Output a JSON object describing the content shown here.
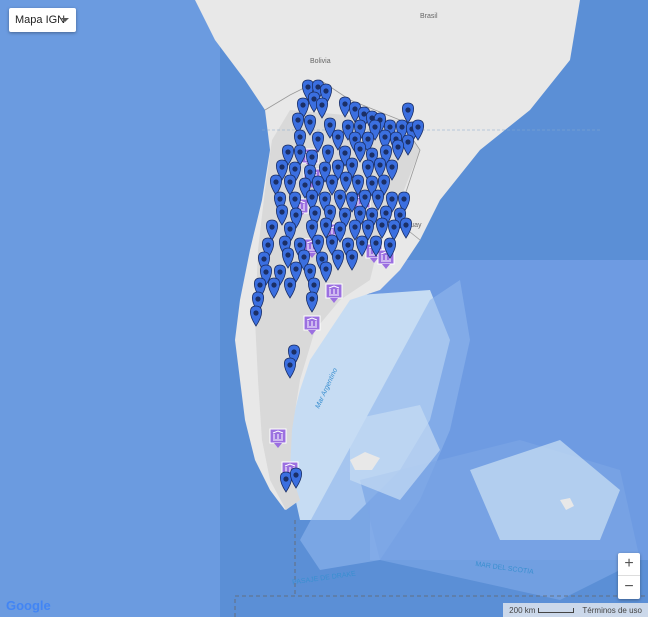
{
  "map_type": {
    "label": "Mapa IGN"
  },
  "place_labels": {
    "brasil": "Brasil",
    "bolivia": "Bolivia",
    "uruguay": "Uruguay",
    "mar_argentino": "Mar Argentino",
    "pasaje_drake": "PASAJE DE DRAKE",
    "mar_scotia": "MAR DEL SCOTIA"
  },
  "zoom": {
    "in": "+",
    "out": "−"
  },
  "footer": {
    "scale": "200 km",
    "terms": "Términos de uso"
  },
  "logo": "Google",
  "colors": {
    "marker": "#3b6fe0",
    "museum_marker": "#9b6fe0",
    "ocean": "#5b8fd6",
    "land": "#e8e8e8",
    "argentina": "#dcdcdc"
  }
}
